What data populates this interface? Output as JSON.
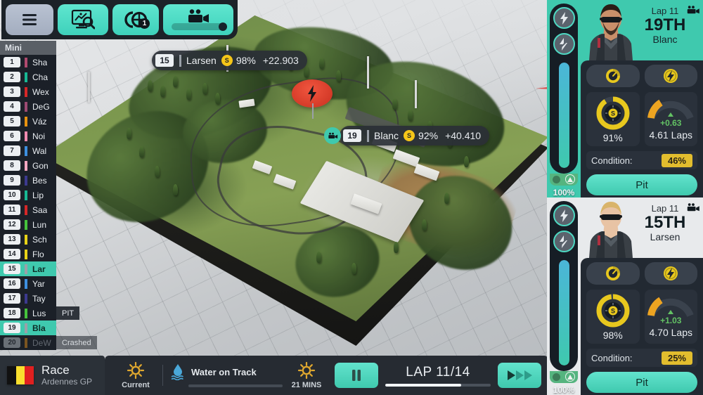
{
  "toolbar": {
    "menu_icon": "hamburger-menu-icon",
    "buttons": [
      {
        "name": "menu",
        "icon": "hamburger-menu-icon"
      },
      {
        "name": "telemetry",
        "icon": "chart-magnifier-icon"
      },
      {
        "name": "strategy",
        "icon": "tyre-strategy-icon",
        "badge": "1"
      },
      {
        "name": "camera",
        "icon": "video-camera-icon"
      }
    ]
  },
  "standings": {
    "header": "Mini",
    "rows": [
      {
        "pos": "1",
        "name": "Sha",
        "color": "#b04a6e",
        "state": "normal",
        "tag": ""
      },
      {
        "pos": "2",
        "name": "Cha",
        "color": "#17b894",
        "state": "normal",
        "tag": ""
      },
      {
        "pos": "3",
        "name": "Wex",
        "color": "#d62828",
        "state": "normal",
        "tag": ""
      },
      {
        "pos": "4",
        "name": "DeG",
        "color": "#9c4a72",
        "state": "normal",
        "tag": ""
      },
      {
        "pos": "5",
        "name": "Váz",
        "color": "#e8920f",
        "state": "normal",
        "tag": ""
      },
      {
        "pos": "6",
        "name": "Noi",
        "color": "#f08ab0",
        "state": "normal",
        "tag": ""
      },
      {
        "pos": "7",
        "name": "Wal",
        "color": "#3d8fe0",
        "state": "normal",
        "tag": ""
      },
      {
        "pos": "8",
        "name": "Gon",
        "color": "#f3a6c0",
        "state": "normal",
        "tag": ""
      },
      {
        "pos": "9",
        "name": "Bes",
        "color": "#3c3a8f",
        "state": "normal",
        "tag": ""
      },
      {
        "pos": "10",
        "name": "Lip",
        "color": "#17b894",
        "state": "normal",
        "tag": ""
      },
      {
        "pos": "11",
        "name": "Saa",
        "color": "#d62828",
        "state": "normal",
        "tag": ""
      },
      {
        "pos": "12",
        "name": "Lun",
        "color": "#46c23c",
        "state": "normal",
        "tag": ""
      },
      {
        "pos": "13",
        "name": "Sch",
        "color": "#e8d317",
        "state": "normal",
        "tag": ""
      },
      {
        "pos": "14",
        "name": "Flo",
        "color": "#e8d317",
        "state": "normal",
        "tag": ""
      },
      {
        "pos": "15",
        "name": "Lar",
        "color": "#9aa0a8",
        "state": "selected",
        "tag": ""
      },
      {
        "pos": "16",
        "name": "Yar",
        "color": "#3d8fe0",
        "state": "normal",
        "tag": ""
      },
      {
        "pos": "17",
        "name": "Tay",
        "color": "#3c3a8f",
        "state": "normal",
        "tag": ""
      },
      {
        "pos": "18",
        "name": "Lus",
        "color": "#46c23c",
        "state": "normal",
        "tag": "PIT"
      },
      {
        "pos": "19",
        "name": "Bla",
        "color": "#9aa0a8",
        "state": "selected",
        "tag": ""
      },
      {
        "pos": "20",
        "name": "DeW",
        "color": "#b5741c",
        "state": "out",
        "tag": "Crashed"
      }
    ]
  },
  "track_labels": [
    {
      "pos": "15",
      "name": "Larsen",
      "tyre": "S",
      "tyre_pct": "98%",
      "gap": "+22.903",
      "camera": false
    },
    {
      "pos": "19",
      "name": "Blanc",
      "tyre": "S",
      "tyre_pct": "92%",
      "gap": "+40.410",
      "camera": true,
      "camera_icon": "video-camera-icon"
    }
  ],
  "hazard": {
    "icon": "lightning-hazard-icon",
    "color": "#d63a28"
  },
  "drivers": [
    {
      "lap": "Lap 11",
      "position": "19TH",
      "name": "Blanc",
      "ers_pct": "100%",
      "ers_fill": 100,
      "tyre_pct": "91%",
      "tyre_compound": "S",
      "fuel_laps": "4.61 Laps",
      "fuel_delta": "+0.63",
      "condition_label": "Condition:",
      "condition_value": "46%",
      "pit_label": "Pit",
      "theme": "teal",
      "hair": "#2a1d16",
      "skin": "#c98f6a",
      "beard": true,
      "camera_icon": "video-camera-icon",
      "mode_icons": [
        "engine-mode-icon",
        "ers-mode-icon"
      ],
      "ers_btn_icons": [
        "lightning-bolt-icon",
        "ers-deploy-icon"
      ]
    },
    {
      "lap": "Lap 11",
      "position": "15TH",
      "name": "Larsen",
      "ers_pct": "100%",
      "ers_fill": 100,
      "tyre_pct": "98%",
      "tyre_compound": "S",
      "fuel_laps": "4.70 Laps",
      "fuel_delta": "+1.03",
      "condition_label": "Condition:",
      "condition_value": "25%",
      "pit_label": "Pit",
      "theme": "light",
      "hair": "#d9b46a",
      "skin": "#e8c3a4",
      "beard": false,
      "camera_icon": "video-camera-icon",
      "mode_icons": [
        "engine-mode-icon",
        "ers-mode-icon"
      ],
      "ers_btn_icons": [
        "lightning-bolt-icon",
        "ers-deploy-icon"
      ]
    }
  ],
  "bottom": {
    "session_type": "Race",
    "event_name": "Ardennes GP",
    "flag_colors": [
      "#111111",
      "#fadf2e",
      "#e02020"
    ],
    "weather_now_label": "Current",
    "weather_now_icon": "sun-icon",
    "weather_next_label": "21 MINS",
    "weather_next_icon": "sun-icon",
    "water_label": "Water on Track",
    "water_icon": "water-droplet-icon",
    "water_level": 0,
    "pause_icon": "pause-icon",
    "lap_text": "LAP 11/14",
    "lap_progress": 72,
    "fastforward_icon": "fast-forward-icon"
  }
}
